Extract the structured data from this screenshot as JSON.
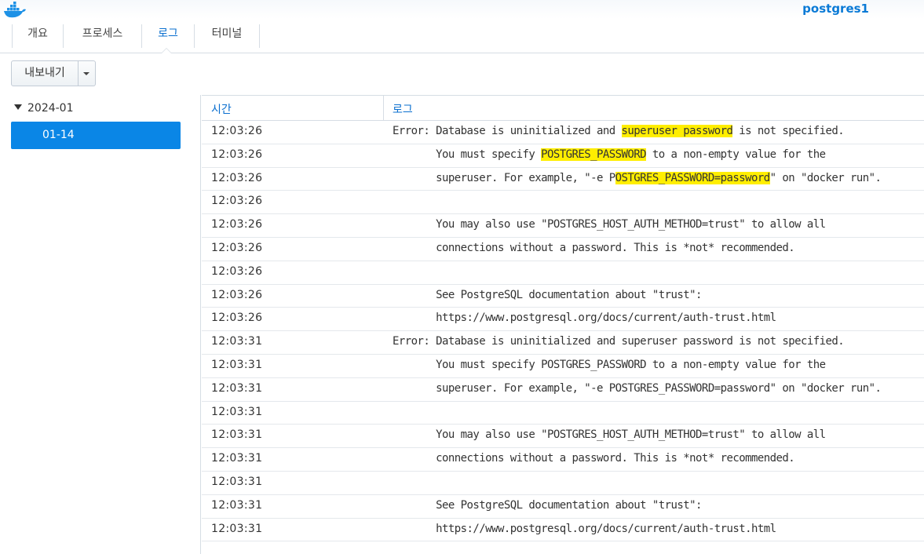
{
  "window": {
    "title": "postgres1",
    "logo": "docker-whale-icon"
  },
  "tabs": [
    {
      "label": "개요",
      "active": false
    },
    {
      "label": "프로세스",
      "active": false
    },
    {
      "label": "로그",
      "active": true
    },
    {
      "label": "터미널",
      "active": false
    }
  ],
  "toolbar": {
    "export_label": "내보내기",
    "export_menu_icon": "caret-down-icon"
  },
  "tree": {
    "group_label": "2024-01",
    "group_icon": "triangle-down-icon",
    "selected_item": "01-14",
    "selected_color": "#0a86e6"
  },
  "log_table": {
    "headers": {
      "time": "시간",
      "log": "로그"
    },
    "highlight_color": "#ffee00",
    "rows": [
      {
        "time": "12:03:26",
        "pre": "Error: Database is uninitialized and ",
        "hl": "superuser password",
        "post": " is not specified."
      },
      {
        "time": "12:03:26",
        "pre": "       You must specify ",
        "hl": "POSTGRES_PASSWORD",
        "post": " to a non-empty value for the"
      },
      {
        "time": "12:03:26",
        "pre": "       superuser. For example, \"-e P",
        "hl": "OSTGRES_PASSWORD=password",
        "post": "\" on \"docker run\"."
      },
      {
        "time": "12:03:26",
        "pre": "",
        "hl": "",
        "post": ""
      },
      {
        "time": "12:03:26",
        "pre": "       You may also use \"POSTGRES_HOST_AUTH_METHOD=trust\" to allow all",
        "hl": "",
        "post": ""
      },
      {
        "time": "12:03:26",
        "pre": "       connections without a password. This is *not* recommended.",
        "hl": "",
        "post": ""
      },
      {
        "time": "12:03:26",
        "pre": "",
        "hl": "",
        "post": ""
      },
      {
        "time": "12:03:26",
        "pre": "       See PostgreSQL documentation about \"trust\":",
        "hl": "",
        "post": ""
      },
      {
        "time": "12:03:26",
        "pre": "       https://www.postgresql.org/docs/current/auth-trust.html",
        "hl": "",
        "post": ""
      },
      {
        "time": "12:03:31",
        "pre": "Error: Database is uninitialized and superuser password is not specified.",
        "hl": "",
        "post": ""
      },
      {
        "time": "12:03:31",
        "pre": "       You must specify POSTGRES_PASSWORD to a non-empty value for the",
        "hl": "",
        "post": ""
      },
      {
        "time": "12:03:31",
        "pre": "       superuser. For example, \"-e POSTGRES_PASSWORD=password\" on \"docker run\".",
        "hl": "",
        "post": ""
      },
      {
        "time": "12:03:31",
        "pre": "",
        "hl": "",
        "post": ""
      },
      {
        "time": "12:03:31",
        "pre": "       You may also use \"POSTGRES_HOST_AUTH_METHOD=trust\" to allow all",
        "hl": "",
        "post": ""
      },
      {
        "time": "12:03:31",
        "pre": "       connections without a password. This is *not* recommended.",
        "hl": "",
        "post": ""
      },
      {
        "time": "12:03:31",
        "pre": "",
        "hl": "",
        "post": ""
      },
      {
        "time": "12:03:31",
        "pre": "       See PostgreSQL documentation about \"trust\":",
        "hl": "",
        "post": ""
      },
      {
        "time": "12:03:31",
        "pre": "       https://www.postgresql.org/docs/current/auth-trust.html",
        "hl": "",
        "post": ""
      }
    ]
  }
}
